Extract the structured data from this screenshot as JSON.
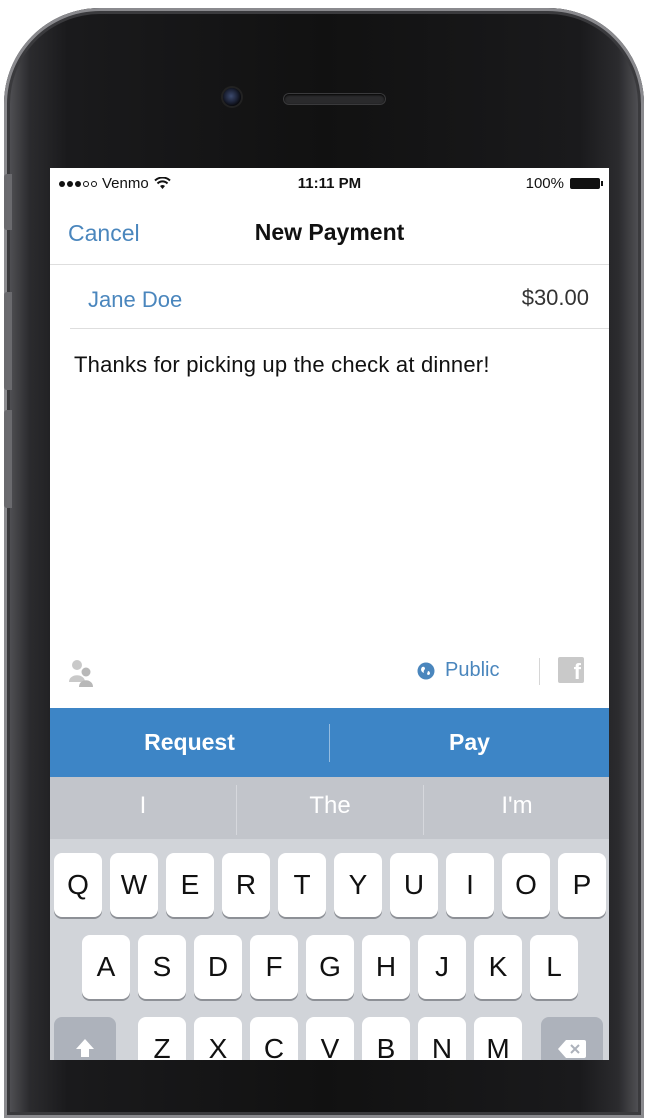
{
  "status_bar": {
    "carrier": "Venmo",
    "time": "11:11 PM",
    "battery": "100%"
  },
  "nav": {
    "cancel": "Cancel",
    "title": "New Payment"
  },
  "payment": {
    "recipient": "Jane Doe",
    "amount": "$30.00",
    "note": "Thanks for picking up the check at dinner!"
  },
  "privacy": {
    "label": "Public",
    "icon": "globe-icon"
  },
  "actions": {
    "request": "Request",
    "pay": "Pay"
  },
  "suggestions": [
    "I",
    "The",
    "I'm"
  ],
  "keyboard": {
    "row1": [
      "Q",
      "W",
      "E",
      "R",
      "T",
      "Y",
      "U",
      "I",
      "O",
      "P"
    ],
    "row2": [
      "A",
      "S",
      "D",
      "F",
      "G",
      "H",
      "J",
      "K",
      "L"
    ],
    "row3": [
      "Z",
      "X",
      "C",
      "V",
      "B",
      "N",
      "M"
    ]
  },
  "colors": {
    "accent": "#4a86bd",
    "action_bar": "#3d85c6",
    "suggestion_bar": "#c2c5cb",
    "keyboard_bg": "#d1d4d9"
  }
}
